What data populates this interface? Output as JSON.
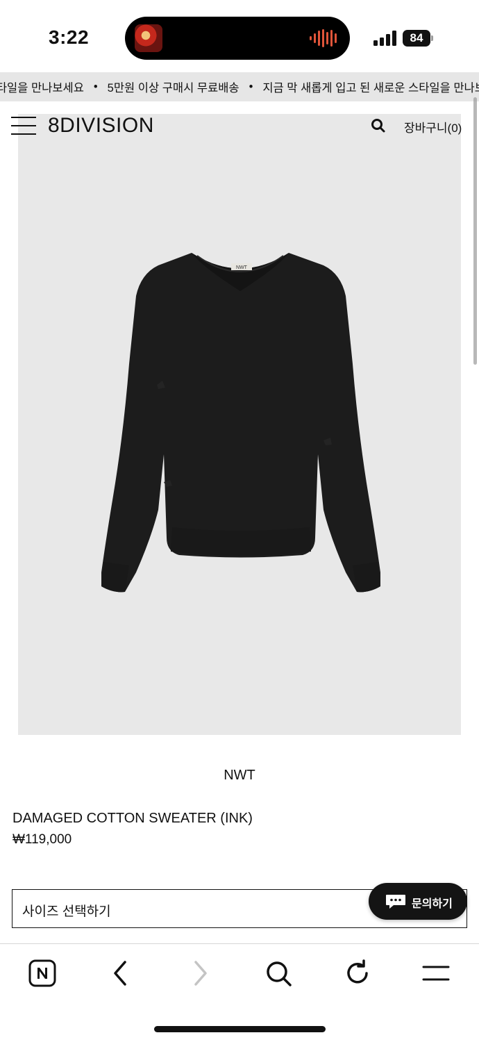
{
  "status_bar": {
    "time": "3:22",
    "battery_percent": "84"
  },
  "marquee": {
    "items": [
      "지금 막 새롭게 입고 된 새로운 스타일을 만나보세요",
      "5만원 이상 구매시 무료배송",
      "지금 막 새롭게 입고 된 새로운 스타일을 만나보세요"
    ],
    "separator": "•"
  },
  "header": {
    "logo": "8DIVISION",
    "cart_label": "장바구니(0)"
  },
  "product": {
    "brand": "NWT",
    "name": "DAMAGED COTTON SWEATER (INK)",
    "price": "₩119,000",
    "label_tag": "NWT"
  },
  "size_select": {
    "placeholder": "사이즈 선택하기"
  },
  "inquiry_button": {
    "label": "문의하기"
  },
  "colors": {
    "marquee_bg": "#e6e6e6",
    "image_bg": "#e8e8e8",
    "sweater": "#1c1c1c",
    "accent_wave": "#e0553a"
  }
}
